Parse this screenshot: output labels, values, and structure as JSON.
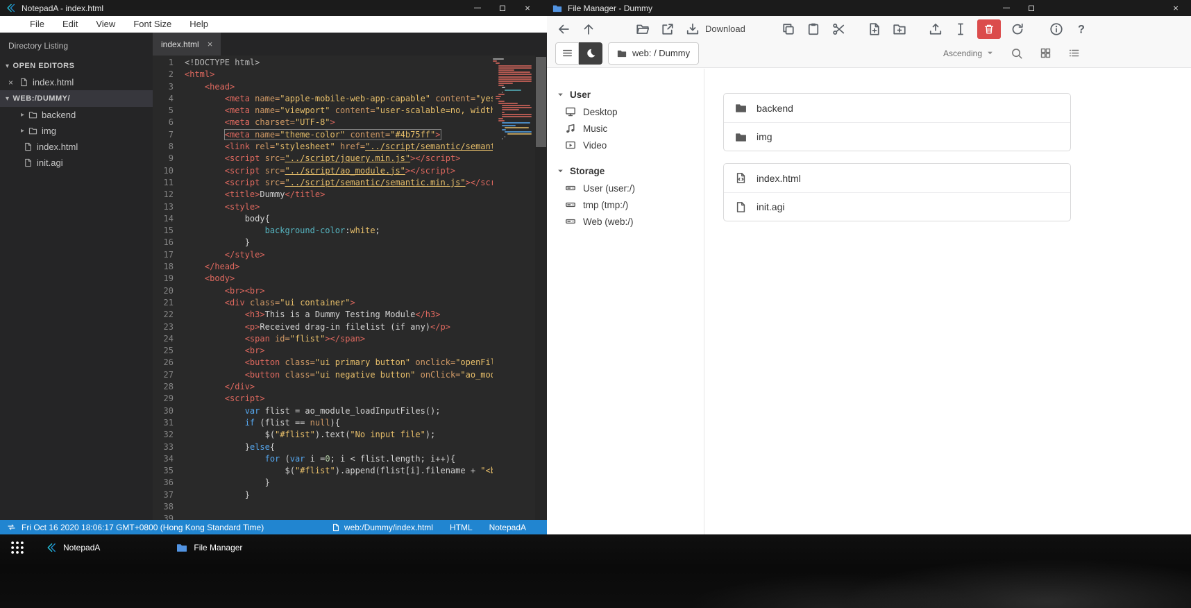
{
  "notepad": {
    "title": "NotepadA - index.html",
    "menu": [
      "File",
      "Edit",
      "View",
      "Font Size",
      "Help"
    ],
    "sidebar": {
      "header": "Directory Listing",
      "sections": [
        {
          "label": "OPEN EDITORS",
          "selected": false,
          "items": [
            {
              "icon": "file",
              "close": true,
              "label": "index.html"
            }
          ]
        },
        {
          "label": "WEB:/DUMMY/",
          "selected": true,
          "items": [
            {
              "icon": "folder",
              "caret": true,
              "label": "backend"
            },
            {
              "icon": "folder",
              "caret": true,
              "label": "img"
            },
            {
              "icon": "file",
              "label": "index.html"
            },
            {
              "icon": "file",
              "label": "init.agi"
            }
          ]
        }
      ]
    },
    "tab": {
      "label": "index.html"
    },
    "status": {
      "left": "Fri Oct 16 2020 18:06:17 GMT+0800 (Hong Kong Standard Time)",
      "path": "web:/Dummy/index.html",
      "lang": "HTML",
      "app": "NotepadA"
    },
    "palette": {
      "d": "#b8b8b8",
      "t": "#e0695f",
      "a": "#d19a66",
      "s": "#e8bf6a",
      "u": "#e8bf6a",
      "p": "#d4d4d4",
      "k": "#56a8f0",
      "c": "#56b6c2",
      "m": "#b5cea8"
    },
    "code_lines": [
      {
        "tk": [
          [
            "d",
            "<!DOCTYPE html>"
          ]
        ]
      },
      {
        "tk": [
          [
            "t",
            "<html>"
          ]
        ]
      },
      {
        "tk": [
          [
            "p",
            "    "
          ],
          [
            "t",
            "<head>"
          ]
        ]
      },
      {
        "tk": [
          [
            "p",
            "        "
          ],
          [
            "t",
            "<meta"
          ],
          [
            "p",
            " "
          ],
          [
            "a",
            "name="
          ],
          [
            "s",
            "\"apple-mobile-web-app-capable\""
          ],
          [
            "p",
            " "
          ],
          [
            "a",
            "content="
          ],
          [
            "s",
            "\"yes\""
          ],
          [
            "t",
            ">"
          ]
        ]
      },
      {
        "tk": [
          [
            "p",
            "        "
          ],
          [
            "t",
            "<meta"
          ],
          [
            "p",
            " "
          ],
          [
            "a",
            "name="
          ],
          [
            "s",
            "\"viewport\""
          ],
          [
            "p",
            " "
          ],
          [
            "a",
            "content="
          ],
          [
            "s",
            "\"user-scalable=no, width=device-width\""
          ],
          [
            "t",
            ">"
          ]
        ]
      },
      {
        "tk": [
          [
            "p",
            "        "
          ],
          [
            "t",
            "<meta"
          ],
          [
            "p",
            " "
          ],
          [
            "a",
            "charset="
          ],
          [
            "s",
            "\"UTF-8\""
          ],
          [
            "t",
            ">"
          ]
        ]
      },
      {
        "box": true,
        "tk": [
          [
            "p",
            "        "
          ],
          [
            "t",
            "<meta"
          ],
          [
            "p",
            " "
          ],
          [
            "a",
            "name="
          ],
          [
            "s",
            "\"theme-color\""
          ],
          [
            "p",
            " "
          ],
          [
            "a",
            "content="
          ],
          [
            "s",
            "\"#4b75ff\""
          ],
          [
            "t",
            ">"
          ]
        ]
      },
      {
        "tk": [
          [
            "p",
            "        "
          ],
          [
            "t",
            "<link"
          ],
          [
            "p",
            " "
          ],
          [
            "a",
            "rel="
          ],
          [
            "s",
            "\"stylesheet\""
          ],
          [
            "p",
            " "
          ],
          [
            "a",
            "href="
          ],
          [
            "u",
            "\"../script/semantic/semantic.min.css\""
          ],
          [
            "t",
            ">"
          ]
        ]
      },
      {
        "tk": [
          [
            "p",
            "        "
          ],
          [
            "t",
            "<script"
          ],
          [
            "p",
            " "
          ],
          [
            "a",
            "src="
          ],
          [
            "u",
            "\"../script/jquery.min.js\""
          ],
          [
            "t",
            "></script>"
          ]
        ]
      },
      {
        "tk": [
          [
            "p",
            "        "
          ],
          [
            "t",
            "<script"
          ],
          [
            "p",
            " "
          ],
          [
            "a",
            "src="
          ],
          [
            "u",
            "\"../script/ao_module.js\""
          ],
          [
            "t",
            "></script>"
          ]
        ]
      },
      {
        "tk": [
          [
            "p",
            "        "
          ],
          [
            "t",
            "<script"
          ],
          [
            "p",
            " "
          ],
          [
            "a",
            "src="
          ],
          [
            "u",
            "\"../script/semantic/semantic.min.js\""
          ],
          [
            "t",
            "></script>"
          ]
        ]
      },
      {
        "tk": [
          [
            "p",
            "        "
          ],
          [
            "t",
            "<title>"
          ],
          [
            "p",
            "Dummy"
          ],
          [
            "t",
            "</title>"
          ]
        ]
      },
      {
        "tk": [
          [
            "p",
            "        "
          ],
          [
            "t",
            "<style>"
          ]
        ]
      },
      {
        "tk": [
          [
            "p",
            "            "
          ],
          [
            "p",
            "body{"
          ]
        ]
      },
      {
        "tk": [
          [
            "p",
            "                "
          ],
          [
            "c",
            "background-color"
          ],
          [
            "p",
            ":"
          ],
          [
            "s",
            "white"
          ],
          [
            "p",
            ";"
          ]
        ]
      },
      {
        "tk": [
          [
            "p",
            "            "
          ],
          [
            "p",
            "}"
          ]
        ]
      },
      {
        "tk": [
          [
            "p",
            "        "
          ],
          [
            "t",
            "</style>"
          ]
        ]
      },
      {
        "tk": [
          [
            "p",
            "    "
          ],
          [
            "t",
            "</head>"
          ]
        ]
      },
      {
        "tk": [
          [
            "p",
            "    "
          ],
          [
            "t",
            "<body>"
          ]
        ]
      },
      {
        "tk": [
          [
            "p",
            "        "
          ],
          [
            "t",
            "<br><br>"
          ]
        ]
      },
      {
        "tk": [
          [
            "p",
            "        "
          ],
          [
            "t",
            "<div"
          ],
          [
            "p",
            " "
          ],
          [
            "a",
            "class="
          ],
          [
            "s",
            "\"ui container\""
          ],
          [
            "t",
            ">"
          ]
        ]
      },
      {
        "tk": [
          [
            "p",
            "            "
          ],
          [
            "t",
            "<h3>"
          ],
          [
            "p",
            "This is a Dummy Testing Module"
          ],
          [
            "t",
            "</h3>"
          ]
        ]
      },
      {
        "tk": [
          [
            "p",
            "            "
          ],
          [
            "t",
            "<p>"
          ],
          [
            "p",
            "Received drag-in filelist (if any)"
          ],
          [
            "t",
            "</p>"
          ]
        ]
      },
      {
        "tk": [
          [
            "p",
            "            "
          ],
          [
            "t",
            "<span"
          ],
          [
            "p",
            " "
          ],
          [
            "a",
            "id="
          ],
          [
            "s",
            "\"flist\""
          ],
          [
            "t",
            "></span>"
          ]
        ]
      },
      {
        "tk": [
          [
            "p",
            "            "
          ],
          [
            "t",
            "<br>"
          ]
        ]
      },
      {
        "tk": [
          [
            "p",
            "            "
          ],
          [
            "t",
            "<button"
          ],
          [
            "p",
            " "
          ],
          [
            "a",
            "class="
          ],
          [
            "s",
            "\"ui primary button\""
          ],
          [
            "p",
            " "
          ],
          [
            "a",
            "onclick="
          ],
          [
            "s",
            "\"openFileSelector()\""
          ],
          [
            "t",
            ">"
          ]
        ]
      },
      {
        "tk": [
          [
            "p",
            "            "
          ],
          [
            "t",
            "<button"
          ],
          [
            "p",
            " "
          ],
          [
            "a",
            "class="
          ],
          [
            "s",
            "\"ui negative button\""
          ],
          [
            "p",
            " "
          ],
          [
            "a",
            "onClick="
          ],
          [
            "s",
            "\"ao_module_close()\""
          ],
          [
            "t",
            ">"
          ]
        ]
      },
      {
        "tk": [
          [
            "p",
            "        "
          ],
          [
            "t",
            "</div>"
          ]
        ]
      },
      {
        "tk": [
          [
            "p",
            "        "
          ],
          [
            "t",
            "<script>"
          ]
        ]
      },
      {
        "tk": [
          [
            "p",
            "            "
          ],
          [
            "k",
            "var"
          ],
          [
            "p",
            " flist = ao_module_loadInputFiles();"
          ]
        ]
      },
      {
        "tk": [
          [
            "p",
            "            "
          ],
          [
            "k",
            "if"
          ],
          [
            "p",
            " (flist == "
          ],
          [
            "a",
            "null"
          ],
          [
            "p",
            "){"
          ]
        ]
      },
      {
        "tk": [
          [
            "p",
            "                "
          ],
          [
            "p",
            "$("
          ],
          [
            "s",
            "\"#flist\""
          ],
          [
            "p",
            ").text("
          ],
          [
            "s",
            "\"No input file\""
          ],
          [
            "p",
            ");"
          ]
        ]
      },
      {
        "tk": [
          [
            "p",
            "            "
          ],
          [
            "p",
            "}"
          ],
          [
            "k",
            "else"
          ],
          [
            "p",
            "{"
          ]
        ]
      },
      {
        "tk": [
          [
            "p",
            "                "
          ],
          [
            "k",
            "for"
          ],
          [
            "p",
            " ("
          ],
          [
            "k",
            "var"
          ],
          [
            "p",
            " i ="
          ],
          [
            "m",
            "0"
          ],
          [
            "p",
            "; i < flist.length; i++){"
          ]
        ]
      },
      {
        "tk": [
          [
            "p",
            "                    "
          ],
          [
            "p",
            "$("
          ],
          [
            "s",
            "\"#flist\""
          ],
          [
            "p",
            ").append(flist[i].filename + "
          ],
          [
            "s",
            "\"<br>\""
          ],
          [
            "p",
            ");"
          ]
        ]
      },
      {
        "tk": [
          [
            "p",
            "                "
          ],
          [
            "p",
            "}"
          ]
        ]
      },
      {
        "tk": [
          [
            "p",
            "            "
          ],
          [
            "p",
            "}"
          ]
        ]
      },
      {
        "tk": []
      },
      {
        "tk": [
          [
            "p",
            "            "
          ]
        ]
      }
    ]
  },
  "filemanager": {
    "title": "File Manager - Dummy",
    "breadcrumb": "web: / Dummy",
    "toolbar": {
      "download_label": "Download",
      "sort_label": "Ascending",
      "row1": [
        {
          "icon": "arrow-left",
          "name": "back-button"
        },
        {
          "icon": "arrow-up",
          "name": "up-button"
        },
        {
          "spacer": 30
        },
        {
          "icon": "folder-open",
          "name": "open-button"
        },
        {
          "icon": "external-link",
          "name": "open-in-new-tab-button"
        },
        {
          "icon": "download-tray",
          "label": "Download",
          "name": "download-button"
        },
        {
          "spacer": 24
        },
        {
          "icon": "copy",
          "name": "copy-button"
        },
        {
          "icon": "paste",
          "name": "paste-button"
        },
        {
          "icon": "scissors",
          "name": "cut-button"
        },
        {
          "spacer": 4
        },
        {
          "icon": "file-plus",
          "name": "new-file-button"
        },
        {
          "icon": "folder-plus",
          "name": "new-folder-button"
        },
        {
          "spacer": 4
        },
        {
          "icon": "upload",
          "name": "upload-button"
        },
        {
          "icon": "ibeam",
          "name": "rename-button"
        },
        {
          "icon": "trash",
          "name": "delete-button",
          "style": "danger"
        },
        {
          "icon": "refresh",
          "name": "refresh-button"
        },
        {
          "spacer": 8
        },
        {
          "icon": "info",
          "name": "info-button"
        },
        {
          "icon": "help",
          "name": "help-button"
        }
      ]
    },
    "sidebar": [
      {
        "label": "User",
        "items": [
          {
            "icon": "desktop",
            "label": "Desktop"
          },
          {
            "icon": "music",
            "label": "Music"
          },
          {
            "icon": "video",
            "label": "Video"
          }
        ]
      },
      {
        "label": "Storage",
        "items": [
          {
            "icon": "drive",
            "label": "User (user:/)"
          },
          {
            "icon": "drive",
            "label": "tmp (tmp:/)"
          },
          {
            "icon": "drive",
            "label": "Web (web:/)"
          }
        ]
      }
    ],
    "files": [
      [
        {
          "icon": "folder-solid",
          "name": "backend"
        },
        {
          "icon": "folder-solid",
          "name": "img"
        }
      ],
      [
        {
          "icon": "file-code",
          "name": "index.html"
        },
        {
          "icon": "file-plain",
          "name": "init.agi"
        }
      ]
    ]
  },
  "taskbar": {
    "apps": [
      {
        "icon": "np-logo",
        "label": "NotepadA"
      },
      {
        "icon": "fm-logo",
        "label": "File Manager"
      }
    ]
  },
  "colors": {
    "status_blue": "#2185d0",
    "danger": "#db4c4c",
    "fm_blue": "#5294e2",
    "np_teal": "#25c3dc"
  }
}
